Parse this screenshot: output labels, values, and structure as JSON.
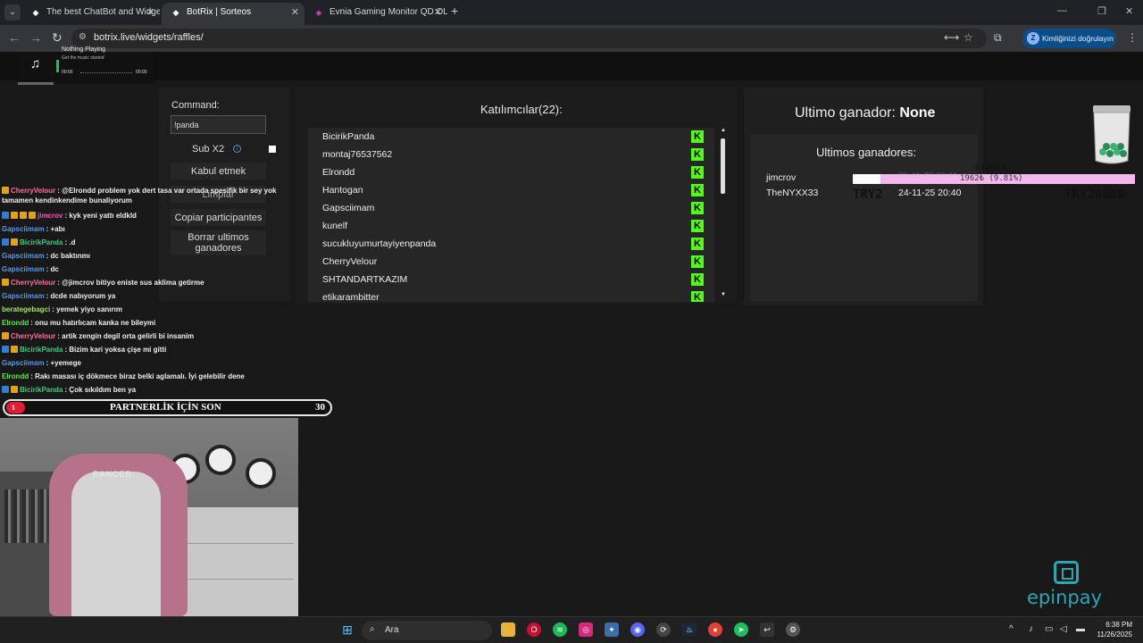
{
  "browser": {
    "tabs": [
      {
        "title": "The best ChatBot and Widgets f",
        "active": false
      },
      {
        "title": "BotRix | Sorteos",
        "active": true
      },
      {
        "title": "Evnia Gaming Monitor QD OLE",
        "active": false
      }
    ],
    "url": "botrix.live/widgets/raffles/",
    "verify_label": "Kimliğinizi doğrulayın",
    "profile_initial": "Z"
  },
  "music": {
    "title": "Nothing Playing",
    "subtitle": "Get the music started",
    "time_start": "00:00",
    "time_end": "00:00"
  },
  "raffle": {
    "command_label": "Command:",
    "command_value": "!panda",
    "sub_label": "Sub X2",
    "buttons": {
      "accept": "Kabul etmek",
      "clear": "Limpiar",
      "copy": "Copiar participantes",
      "delete_winners": "Borrar ultimos ganadores"
    },
    "participants_title": "Katılımcılar(22):",
    "participants": [
      "BicirikPanda",
      "montaj76537562",
      "Elrondd",
      "Hantogan",
      "Gapsciimam",
      "kunelf",
      "sucukluyumurtayiyenpanda",
      "CherryVelour",
      "SHTANDARTKAZIM",
      "etikarambitter"
    ],
    "last_winner_label": "Ultimo ganador:",
    "last_winner_value": "None",
    "winners_title": "Ultimos ganadores:",
    "winners": [
      {
        "name": "jimcrov",
        "date": ""
      },
      {
        "name": "TheNYXX33",
        "date": "24-11-25 20:40"
      }
    ]
  },
  "overlay": {
    "kamera": "KAMERA",
    "goal_text": "1962₺ (9.81%)",
    "goal_fraction": 0.0981,
    "try_left": "TRY2",
    "try_right": "TRY20000",
    "ghost_date": "25-11-25 20:11"
  },
  "chat": [
    {
      "user": "CherryVelour",
      "color": "#ff6f9a",
      "badges": [
        "sub"
      ],
      "text": ": @Elrondd problem yok dert tasa var ortada spesifik bir sey yok tamamen kendinkendime bunaliyorum",
      "wrap": true
    },
    {
      "user": "jimcrov",
      "color": "#ff4fb8",
      "badges": [
        "vip",
        "sub",
        "sub",
        "sub"
      ],
      "text": ": kyk yeni yattı eldkld",
      "wrap": false
    },
    {
      "user": "Gapsciimam",
      "color": "#4f9cf0",
      "badges": [],
      "text": ": +abı",
      "wrap": false
    },
    {
      "user": "BicirikPanda",
      "color": "#33d17a",
      "badges": [
        "vip",
        "sub"
      ],
      "text": ": .d",
      "wrap": false
    },
    {
      "user": "Gapsciimam",
      "color": "#4f9cf0",
      "badges": [],
      "text": ": dc baktınmı",
      "wrap": false
    },
    {
      "user": "Gapsciimam",
      "color": "#4f9cf0",
      "badges": [],
      "text": ": dc",
      "wrap": false
    },
    {
      "user": "CherryVelour",
      "color": "#ff6f9a",
      "badges": [
        "sub"
      ],
      "text": ": @jimcrov bitiyo eniste sus aklima getirme",
      "wrap": false
    },
    {
      "user": "Gapsciimam",
      "color": "#4f9cf0",
      "badges": [],
      "text": ": dcde nabıyorum ya",
      "wrap": false
    },
    {
      "user": "berategebagci",
      "color": "#a5e34f",
      "badges": [],
      "text": ": yemek yiyo sanırım",
      "wrap": false
    },
    {
      "user": "Elrondd",
      "color": "#5fe04a",
      "badges": [],
      "text": ": onu mu hatırlıcam kanka ne bileymi",
      "wrap": false
    },
    {
      "user": "CherryVelour",
      "color": "#ff6f9a",
      "badges": [
        "sub"
      ],
      "text": ": artik zengin degil orta gelirli bi insanim",
      "wrap": false
    },
    {
      "user": "BicirikPanda",
      "color": "#33d17a",
      "badges": [
        "vip",
        "sub"
      ],
      "text": ": Bizim kari yoksa çişe mi gitti",
      "wrap": false
    },
    {
      "user": "Gapsciimam",
      "color": "#4f9cf0",
      "badges": [],
      "text": ": +yemege",
      "wrap": false
    },
    {
      "user": "Elrondd",
      "color": "#5fe04a",
      "badges": [],
      "text": ": Rakı masası iç dökmece biraz belki aglamalı. İyi gelebilir dene",
      "wrap": false
    },
    {
      "user": "BicirikPanda",
      "color": "#33d17a",
      "badges": [
        "vip",
        "sub"
      ],
      "text": ": Çok sıkıldım ben ya",
      "wrap": false
    }
  ],
  "partnership": {
    "count": "1",
    "label": "PARTNERLİK İÇİN SON",
    "goal": "30"
  },
  "cam": {
    "chair_brand": "RANCER"
  },
  "brand": {
    "epinpay": "epinpay"
  },
  "taskbar": {
    "search_label": "Ara",
    "time": "6:38 PM",
    "date": "11/26/2025"
  }
}
